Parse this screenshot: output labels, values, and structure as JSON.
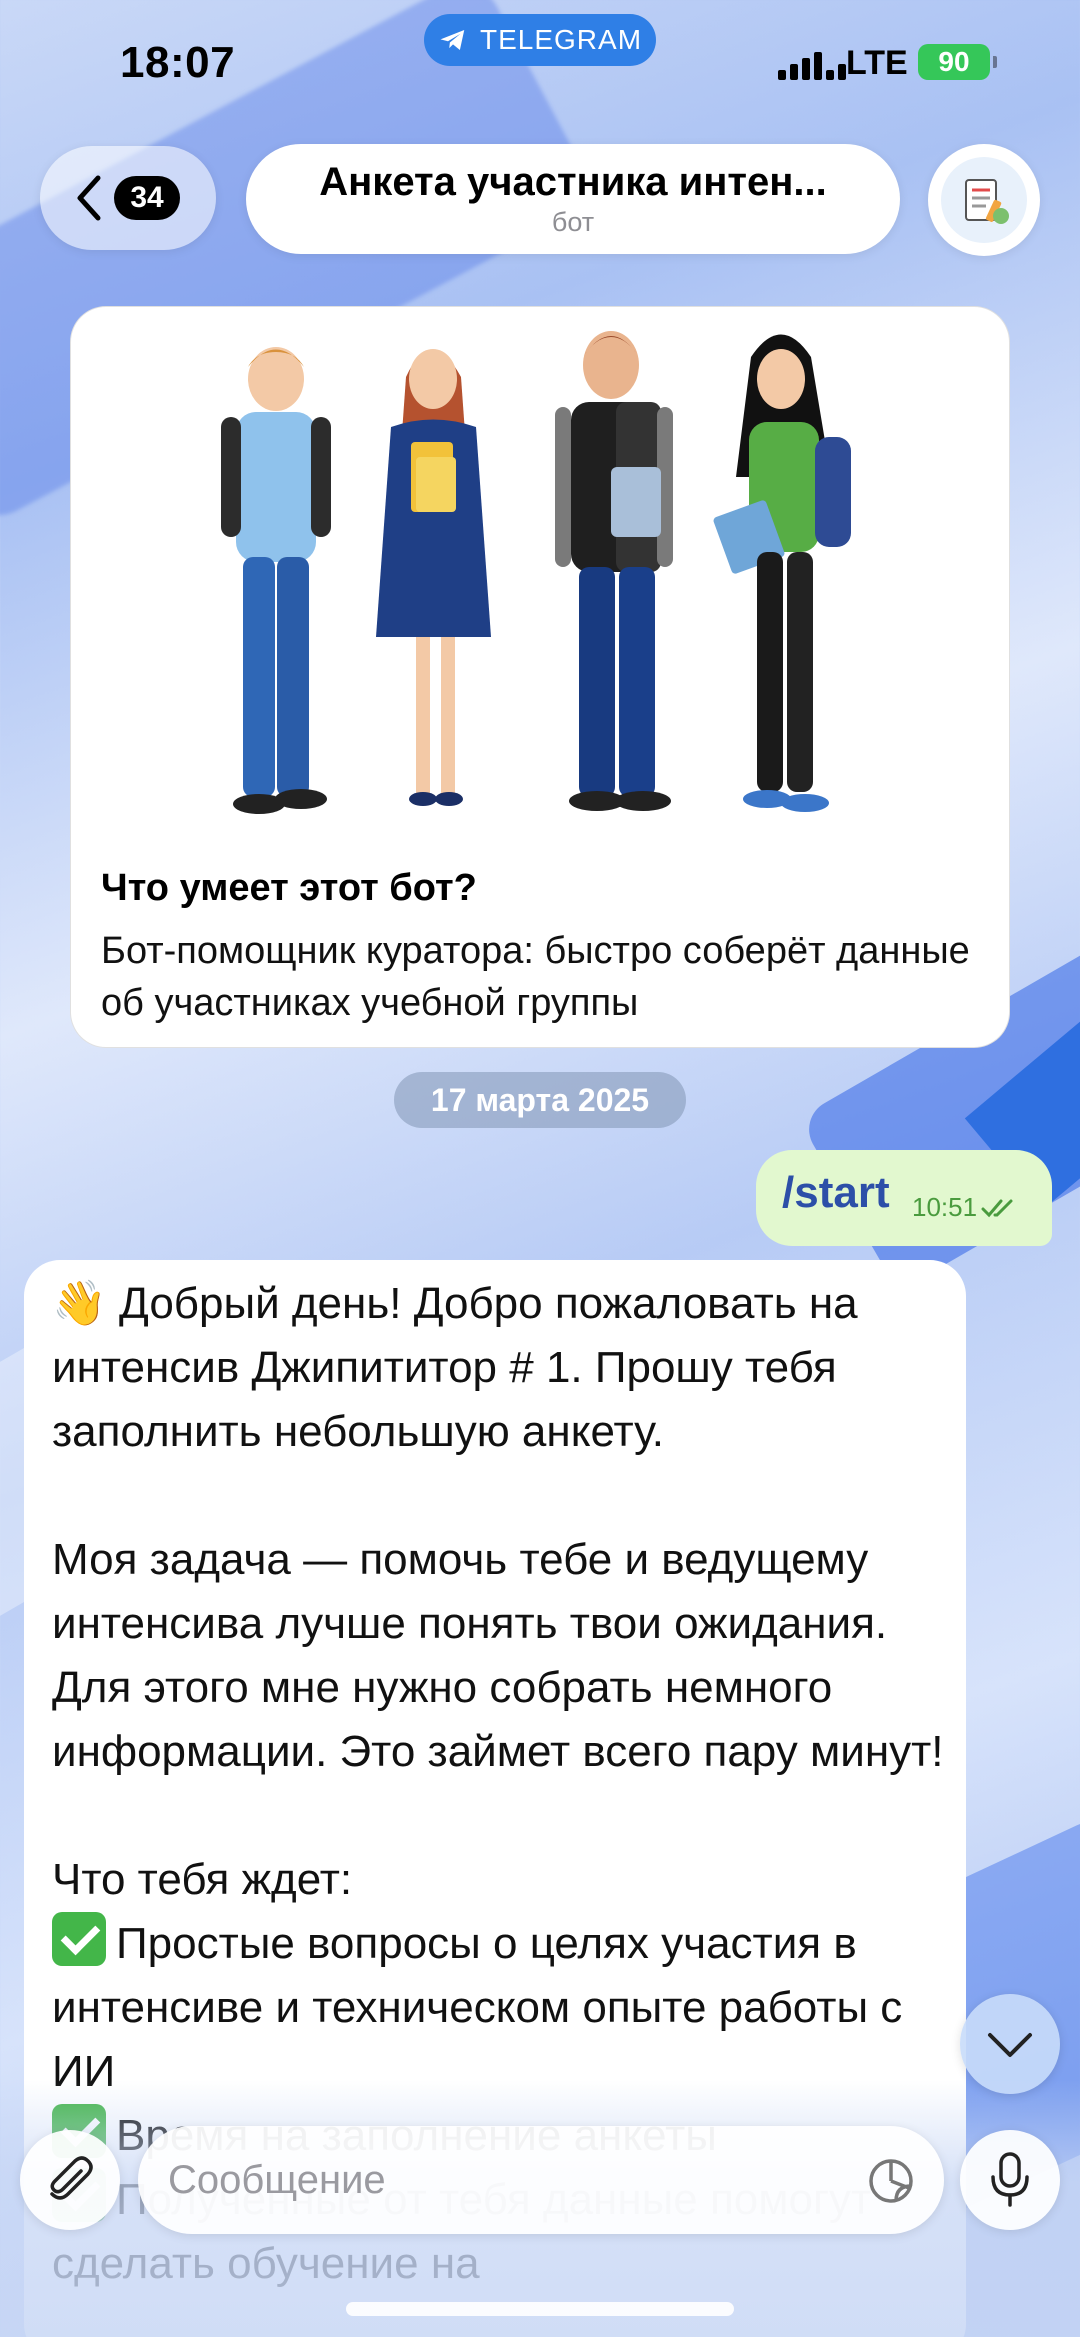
{
  "status_bar": {
    "time": "18:07",
    "carrier_pill": "TELEGRAM",
    "network": "LTE",
    "battery": "90"
  },
  "header": {
    "back_badge": "34",
    "title": "Анкета участника интен...",
    "subtitle": "бот",
    "avatar_icon": "checklist-clipboard-icon"
  },
  "bot_info": {
    "heading": "Что умеет этот бот?",
    "description": "Бот-помощник куратора: быстро соберёт данные об участниках учебной группы"
  },
  "date_chip": "17 марта 2025",
  "outgoing_message": {
    "text": "/start",
    "time": "10:51"
  },
  "incoming_message": {
    "greeting_emoji": "👋",
    "line1": " Добрый день! Добро пожаловать на интенсив Джипититор # 1. Прошу тебя заполнить небольшую анкету.",
    "para2": "Моя задача — помочь тебе и ведущему интенсива лучше понять твои ожидания. Для этого мне нужно собрать немного информации. Это займет всего пару минут!",
    "para3_heading": "Что тебя ждет:",
    "item1": "Простые вопросы о целях участия в интенсиве и техническом опыте работы с ИИ",
    "item2": "Время на заполнение анкеты",
    "item3": "Полученные от тебя данные помогут сделать обучение на"
  },
  "input": {
    "placeholder": "Сообщение"
  },
  "colors": {
    "accent": "#2f7fe6",
    "outgoing_bubble": "#e2f8cf",
    "check_green": "#43b649"
  }
}
